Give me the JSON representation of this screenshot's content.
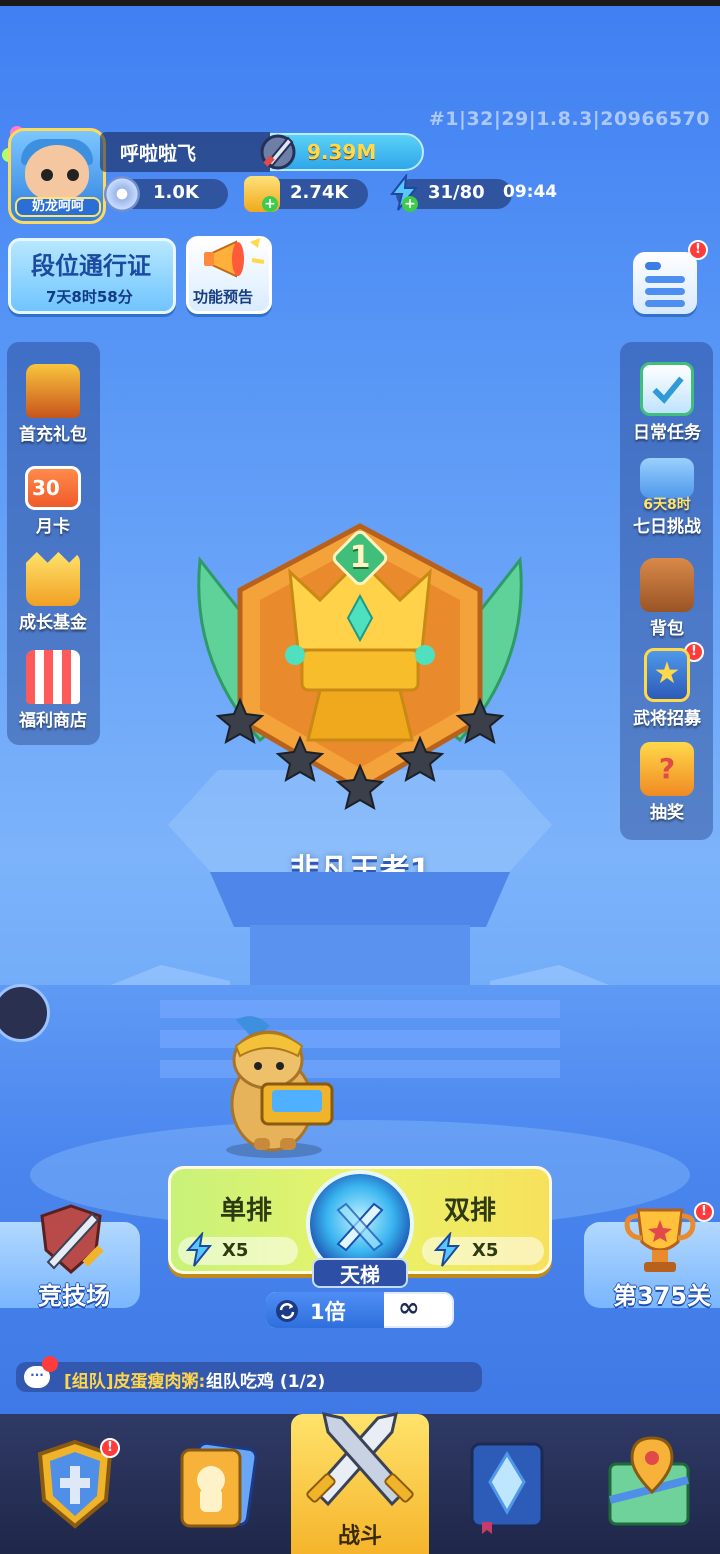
{
  "version": "#1|32|29|1.8.3|20966570",
  "player": {
    "name": "呼啦啦飞",
    "power": "9.39M",
    "avatar_tag": "奶龙呵呵"
  },
  "resources": {
    "silver": "1.0K",
    "gold": "2.74K",
    "energy": "31/80",
    "energy_timer": "09:44"
  },
  "top_buttons": {
    "pass_title": "段位通行证",
    "pass_timer": "7天8时58分",
    "preview": "功能预告"
  },
  "left_sidebar": [
    {
      "label": "首充礼包",
      "icon": "treasure-chest-icon"
    },
    {
      "label": "月卡",
      "icon": "monthly-card-icon",
      "icon_text": "30"
    },
    {
      "label": "成长基金",
      "icon": "growth-fund-icon"
    },
    {
      "label": "福利商店",
      "icon": "shop-icon"
    }
  ],
  "right_sidebar": [
    {
      "label": "日常任务",
      "icon": "clipboard-check-icon"
    },
    {
      "label": "七日挑战",
      "icon": "scroll-icon",
      "timer": "6天8时"
    },
    {
      "label": "背包",
      "icon": "backpack-icon"
    },
    {
      "label": "武将招募",
      "icon": "star-card-icon"
    },
    {
      "label": "抽奖",
      "icon": "lottery-icon"
    }
  ],
  "rank": {
    "level": "1",
    "name": "非凡王者1",
    "stars_total": 5,
    "stars_filled": 0
  },
  "match": {
    "solo_label": "单排",
    "solo_cost": "X5",
    "duo_label": "双排",
    "duo_cost": "X5",
    "ladder_label": "天梯",
    "multiplier": "1倍",
    "limit": "∞"
  },
  "side_modes": {
    "arena": "竞技场",
    "stage": "第375关"
  },
  "chat": {
    "channel": "[组队]皮蛋瘦肉粥:",
    "message": "组队吃鸡 (1/2)",
    "icon_text": "···"
  },
  "nav": {
    "battle": "战斗"
  },
  "colors": {
    "accent": "#ffd94a",
    "badge": "#ff3b3b",
    "panel_green": "#c8f27a",
    "panel_yellow": "#f7e15c"
  }
}
